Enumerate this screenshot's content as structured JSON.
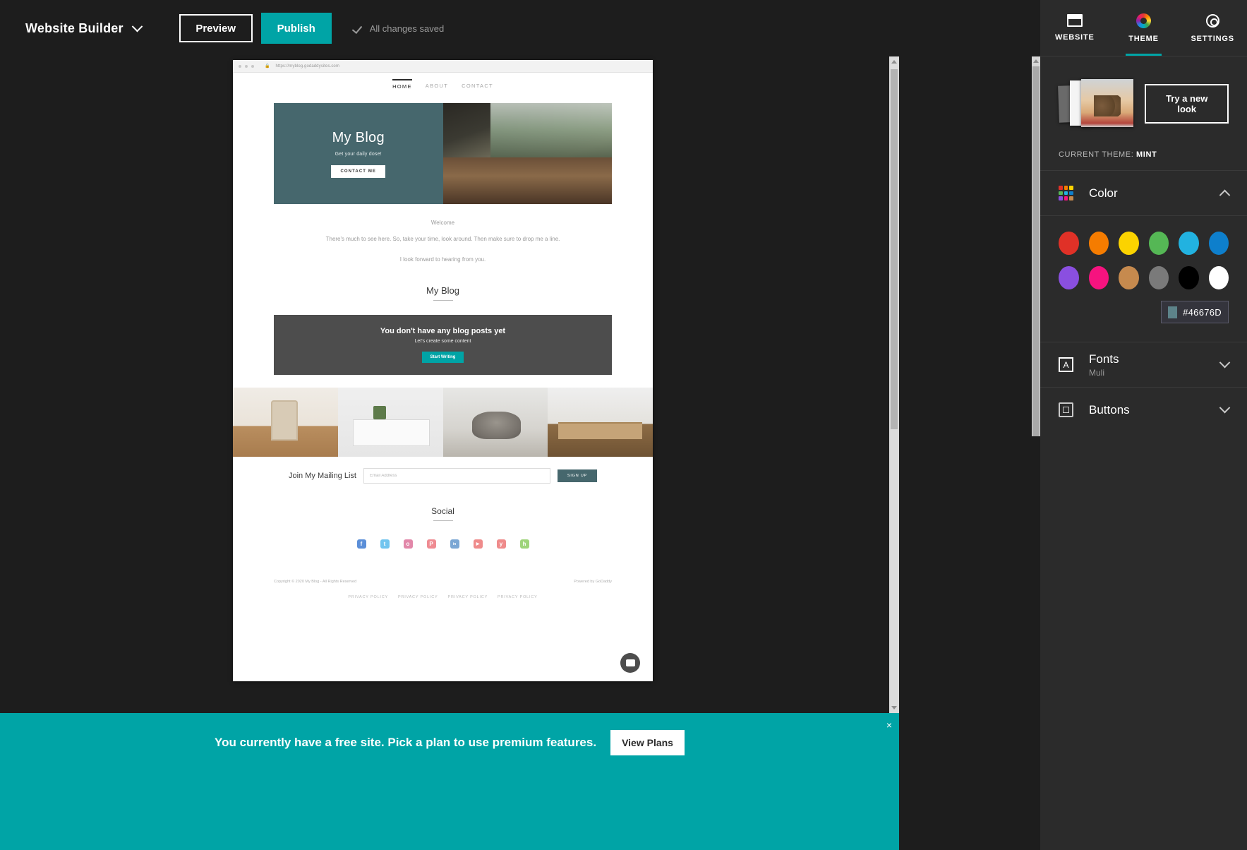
{
  "topbar": {
    "brand": "Website Builder",
    "preview_label": "Preview",
    "publish_label": "Publish",
    "saved_status": "All changes saved",
    "chevron_icon": "chevron-down-icon",
    "check_icon": "check-icon"
  },
  "site_preview": {
    "url": "https://myblog.godaddysites.com",
    "lock_icon": "lock-icon",
    "nav": [
      {
        "label": "HOME",
        "active": true
      },
      {
        "label": "ABOUT",
        "active": false
      },
      {
        "label": "CONTACT",
        "active": false
      }
    ],
    "hero": {
      "title": "My Blog",
      "subtitle": "Get your daily dose!",
      "cta": "CONTACT ME",
      "bg_color": "#46676D"
    },
    "welcome": {
      "title": "Welcome",
      "paragraph1": "There's much to see here. So, take your time, look around. Then make sure to drop me a line.",
      "paragraph2": "I look forward to hearing from you."
    },
    "blog_section": {
      "heading": "My Blog",
      "empty_title": "You don't have any blog posts yet",
      "empty_subtitle": "Let's create some content",
      "cta": "Start Writing"
    },
    "mailing": {
      "title": "Join My Mailing List",
      "placeholder": "Email Address",
      "value": "",
      "button": "SIGN UP"
    },
    "social": {
      "title": "Social",
      "icons": [
        {
          "name": "facebook-icon",
          "glyph": "f",
          "color": "#5b8fd8"
        },
        {
          "name": "twitter-icon",
          "glyph": "t",
          "color": "#72c5ef"
        },
        {
          "name": "instagram-icon",
          "glyph": "o",
          "color": "#e287a9"
        },
        {
          "name": "pinterest-icon",
          "glyph": "P",
          "color": "#ef8b92"
        },
        {
          "name": "linkedin-icon",
          "glyph": "in",
          "color": "#7ba7d4"
        },
        {
          "name": "youtube-icon",
          "glyph": "▶",
          "color": "#ef8b8b"
        },
        {
          "name": "yelp-icon",
          "glyph": "y",
          "color": "#ef8b8b"
        },
        {
          "name": "houzz-icon",
          "glyph": "h",
          "color": "#9ed47a"
        }
      ]
    },
    "footer": {
      "copyright": "Copyright © 2020 My Blog - All Rights Reserved",
      "powered": "Powered by GoDaddy",
      "privacy_links": [
        "PRIVACY POLICY",
        "PRIVACY POLICY",
        "PRIVACY POLICY",
        "PRIVACY POLICY"
      ]
    },
    "chat_icon": "chat-bubble-icon"
  },
  "panel": {
    "tabs": [
      {
        "label": "WEBSITE",
        "icon": "window-icon",
        "active": false
      },
      {
        "label": "THEME",
        "icon": "color-wheel-icon",
        "active": true
      },
      {
        "label": "SETTINGS",
        "icon": "gear-icon",
        "active": false
      }
    ],
    "try_new_look": "Try a new look",
    "current_theme_label": "CURRENT THEME:",
    "current_theme_name": "MINT",
    "sections": [
      {
        "title": "Color",
        "subtitle": "",
        "icon": "color-grid-icon",
        "expanded": true
      },
      {
        "title": "Fonts",
        "subtitle": "Muli",
        "icon": "font-icon",
        "expanded": false
      },
      {
        "title": "Buttons",
        "subtitle": "",
        "icon": "button-icon",
        "expanded": false
      }
    ],
    "color_swatches_row1": [
      {
        "name": "red",
        "hex": "#E03127"
      },
      {
        "name": "orange",
        "hex": "#F57C00"
      },
      {
        "name": "yellow",
        "hex": "#FBD300"
      },
      {
        "name": "green",
        "hex": "#55B755"
      },
      {
        "name": "cyan",
        "hex": "#22B2E0"
      },
      {
        "name": "blue",
        "hex": "#0E7FCC"
      }
    ],
    "color_swatches_row2": [
      {
        "name": "purple",
        "hex": "#8A4FE0"
      },
      {
        "name": "pink",
        "hex": "#F6137F"
      },
      {
        "name": "tan",
        "hex": "#C68A4E"
      },
      {
        "name": "gray",
        "hex": "#7A7A7A"
      },
      {
        "name": "black",
        "hex": "#000000"
      },
      {
        "name": "white",
        "hex": "#FFFFFF"
      }
    ],
    "selected_hex": "#46676D",
    "selected_hex_swatch": "#5D838A"
  },
  "banner": {
    "message": "You currently have a free site. Pick a plan to use premium features.",
    "button": "View Plans",
    "close_icon": "close-icon",
    "close_glyph": "×"
  }
}
